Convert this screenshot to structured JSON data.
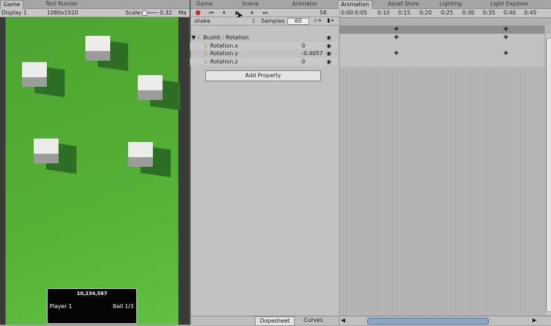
{
  "game_panel": {
    "tabs": [
      {
        "label": "Game"
      },
      {
        "label": "Test Runner"
      }
    ],
    "toolbar": {
      "display": "Display 1",
      "resolution": "1080x1920",
      "scale_label": "Scale",
      "scale_value": "0.32",
      "maximize_label": "Ma"
    },
    "hud": {
      "score": "10,234,567",
      "player": "Player 1",
      "ball": "Ball 1/3"
    }
  },
  "right_tabs": [
    {
      "label": "Game"
    },
    {
      "label": "Scene"
    },
    {
      "label": "Animator"
    },
    {
      "label": "Animation"
    },
    {
      "label": "Asset Store"
    },
    {
      "label": "Lighting"
    },
    {
      "label": "Light Explorer"
    }
  ],
  "animation": {
    "frame_value": "58",
    "clip_name": "shake",
    "samples_label": "Samples",
    "samples_value": "60",
    "properties": [
      {
        "label": "Bush0 : Rotation",
        "value": ""
      },
      {
        "label": "Rotation.x",
        "value": "0"
      },
      {
        "label": "Rotation.y",
        "value": "-0.4057"
      },
      {
        "label": "Rotation.z",
        "value": "0"
      }
    ],
    "add_property_label": "Add Property",
    "dopesheet_label": "Dopesheet",
    "curves_label": "Curves",
    "timeline_ticks": [
      "0:00",
      "0:05",
      "0:10",
      "0:15",
      "0:20",
      "0:25",
      "0:30",
      "0:35",
      "0:40",
      "0:45"
    ]
  },
  "colors": {
    "field_green": "#52ae35",
    "record_red": "#d4202a",
    "hud_bg": "#050505"
  }
}
